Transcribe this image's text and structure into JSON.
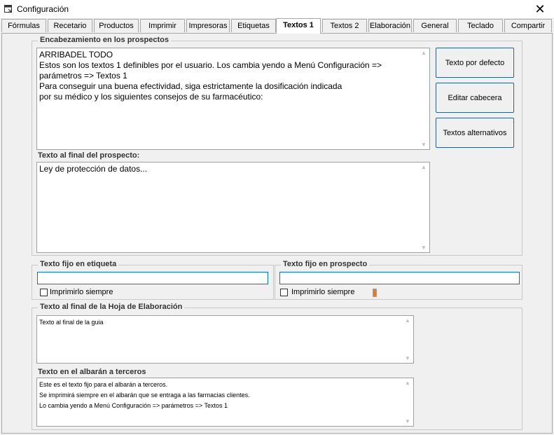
{
  "window": {
    "title": "Configuración",
    "close_glyph": "✕"
  },
  "tabs": [
    {
      "label": "Fórmulas"
    },
    {
      "label": "Recetario"
    },
    {
      "label": "Productos"
    },
    {
      "label": "Imprimir"
    },
    {
      "label": "Impresoras"
    },
    {
      "label": "Etiquetas"
    },
    {
      "label": "Textos 1",
      "active": true
    },
    {
      "label": "Textos 2"
    },
    {
      "label": "Elaboración"
    },
    {
      "label": "General"
    },
    {
      "label": "Teclado"
    },
    {
      "label": "Compartir"
    }
  ],
  "header_group": {
    "title": "Encabezamiento en los prospectos",
    "header_text": "ARRIBADEL TODO\nEstos son los textos 1 definibles por el usuario. Los cambia yendo a Menú Configuración =>\nparámetros => Textos 1\nPara conseguir una buena efectividad, siga estrictamente la dosificación indicada\npor su médico y los siguientes consejos de su farmacéutico:",
    "footer_label": "Texto al final del prospecto:",
    "footer_text": "Ley de protección de datos..."
  },
  "buttons": {
    "default_text": "Texto por defecto",
    "edit_header": "Editar cabecera",
    "alt_texts": "Textos alternativos"
  },
  "label_group": {
    "title": "Texto fijo en etiqueta",
    "value": "",
    "checkbox_label": "Imprimirlo siempre",
    "checked": false
  },
  "leaflet_group": {
    "title": "Texto fijo en prospecto",
    "value": "",
    "checkbox_label": "Imprimirlo siempre",
    "checked": false
  },
  "elab_group": {
    "title": "Texto al final de la Hoja de Elaboración",
    "elab_text": "Texto al final de la guia",
    "delivery_label": "Texto en el albarán a terceros",
    "delivery_text": "Este es el texto fijo para el albarán a terceros.\nSe imprimirá siempre en el albarán que se entraga a las farmacias clientes.\nLo cambia yendo a Menú Configuración => parámetros => Textos 1"
  },
  "colors": {
    "accent": "#0078d7",
    "button_border": "#235a9c",
    "marker": "#e8791d"
  },
  "icons": {
    "app": "window-icon",
    "scroll_up": "scroll-up-icon",
    "scroll_down": "scroll-down-icon"
  }
}
